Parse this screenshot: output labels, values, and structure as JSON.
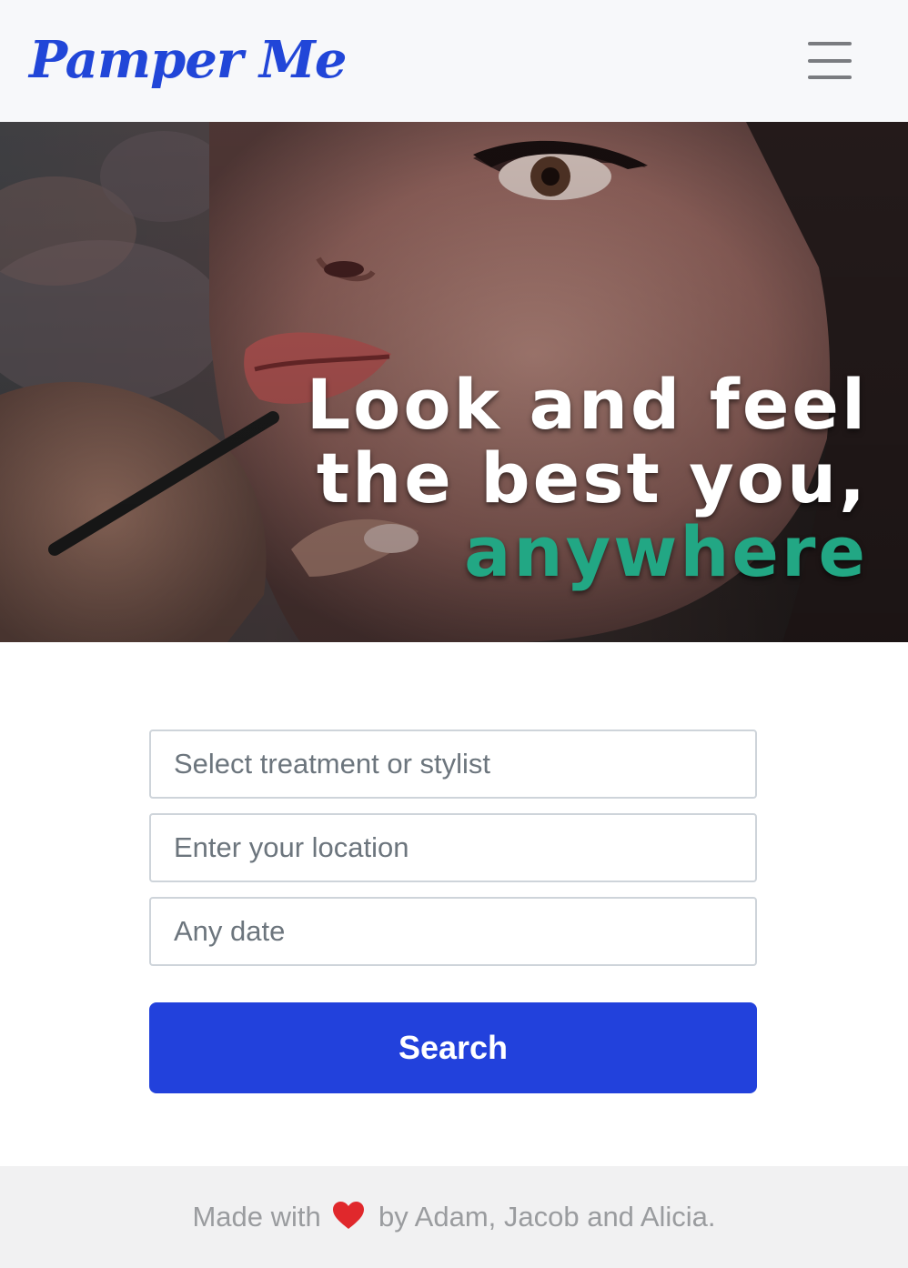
{
  "navbar": {
    "brand": "Pamper Me",
    "menu_icon": "hamburger-menu-icon",
    "brand_color": "#2146d8"
  },
  "hero": {
    "line1": "Look and feel",
    "line2": "the best you,",
    "line3": "anywhere",
    "accent_color": "#22a784",
    "background_image": "photo of makeup artist applying lip liner to a woman"
  },
  "search": {
    "treatment_placeholder": "Select treatment or stylist",
    "location_placeholder": "Enter your location",
    "date_placeholder": "Any date",
    "button_label": "Search",
    "button_color": "#2241dc"
  },
  "footer": {
    "prefix": "Made with",
    "heart_icon": "heart-icon",
    "suffix": "by Adam, Jacob and Alicia.",
    "heart_color": "#e0282c"
  }
}
